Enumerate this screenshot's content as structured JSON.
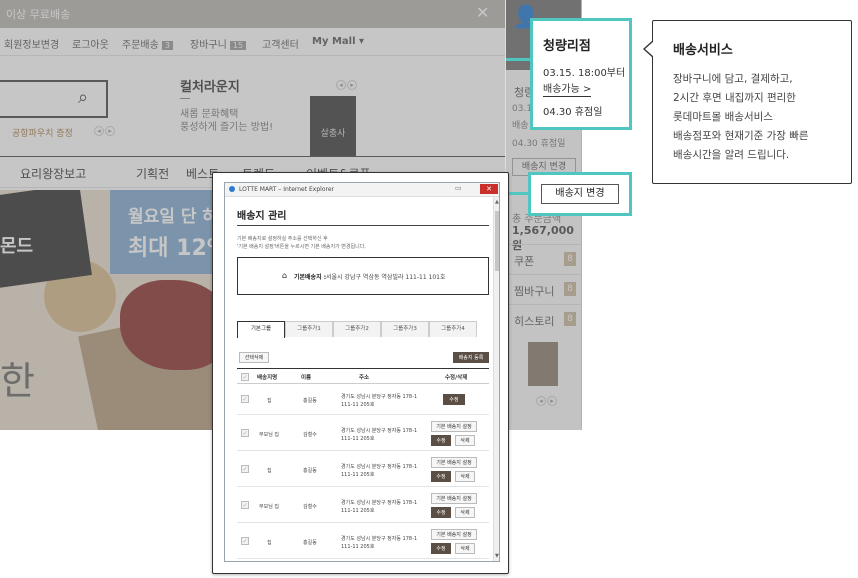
{
  "site": {
    "topbar_text": "이상 무료배송",
    "util_links": [
      {
        "label": "회원정보변경",
        "count": ""
      },
      {
        "label": "로그아웃",
        "count": ""
      },
      {
        "label": "주문배송",
        "count": "3"
      },
      {
        "label": "장바구니",
        "count": "15"
      },
      {
        "label": "고객센터",
        "count": ""
      },
      {
        "label": "My Mall ▾",
        "count": ""
      }
    ],
    "search_promo": "공항파우치 증정",
    "lounge": {
      "title": "컬처라운지",
      "line1": "새롭 문화혜택",
      "line2": "풍성하게 즐기는 방법!"
    },
    "book_title": "살충사",
    "gnb": [
      "요리왕장보고",
      "기획전",
      "베스트",
      "트렌드",
      "이벤트&쿠폰"
    ],
    "banner": {
      "line1": "월요일 단 하루",
      "line2": "최대 12%",
      "bag_text": "몬드",
      "side_text": "한"
    }
  },
  "right_panel": {
    "store_fragment": "청량",
    "info": [
      "03.15",
      "배송",
      "04.30 휴점일"
    ],
    "change_label": "배송지 변경",
    "amount_label": "총 주문금액",
    "amount": "1,567,000원",
    "rows": [
      {
        "label": "쿠폰",
        "count": "8"
      },
      {
        "label": "찜바구니",
        "count": "8"
      },
      {
        "label": "히스토리",
        "count": "8"
      }
    ]
  },
  "store_card": {
    "name": "청량리점",
    "time": "03.15. 18:00부터",
    "available": "배송가능 >",
    "closed": "04.30 휴점일"
  },
  "change_button": {
    "label": "배송지 변경"
  },
  "callout": {
    "title": "배송서비스",
    "lines": [
      "장바구니에 담고, 결제하고,",
      "2시간 후면 내집까지 편리한",
      "롯데마트몰 배송서비스",
      "배송점포와 현재기준 가장 빠른",
      "배송시간을 알려 드립니다."
    ]
  },
  "ie_window": {
    "title": "LOTTE MART – Internet Explorer",
    "minmax": "▭",
    "close": "✕",
    "page_title": "배송지 관리",
    "desc1": "기본 배송지로 설정하실 주소를 선택하신 후",
    "desc2": "'기본 배송지 설정'버튼을 누르시면 기본 배송지가 변경됩니다.",
    "default_label": "기본배송지 :",
    "default_address": "서울시 강남구 역삼동 역삼빌라 111-11 101호",
    "tabs": [
      "기본그룹",
      "그룹추가1",
      "그룹추가2",
      "그룹추가3",
      "그룹추가4"
    ],
    "select_delete": "선택삭제",
    "register": "배송지 등록",
    "columns": [
      "배송지명",
      "이름",
      "주소",
      "수정/삭제"
    ],
    "rows": [
      {
        "place": "집",
        "name": "홍길동",
        "addr1": "경기도 성남시 분당구 정자동 178-1",
        "addr2": "111-11 205호",
        "default_btn": "",
        "edit": "수정",
        "del": ""
      },
      {
        "place": "부모님 집",
        "name": "김철수",
        "addr1": "경기도 성남시 분당구 정자동 178-1",
        "addr2": "111-11 205호",
        "default_btn": "기본 배송지 설정",
        "edit": "수정",
        "del": "삭제"
      },
      {
        "place": "집",
        "name": "홍길동",
        "addr1": "경기도 성남시 분당구 정자동 178-1",
        "addr2": "111-11 205호",
        "default_btn": "기본 배송지 설정",
        "edit": "수정",
        "del": "삭제"
      },
      {
        "place": "부모님 집",
        "name": "김철수",
        "addr1": "경기도 성남시 분당구 정자동 178-1",
        "addr2": "111-11 205호",
        "default_btn": "기본 배송지 설정",
        "edit": "수정",
        "del": "삭제"
      },
      {
        "place": "집",
        "name": "홍길동",
        "addr1": "경기도 성남시 분당구 정자동 178-1",
        "addr2": "111-11 205호",
        "default_btn": "기본 배송지 설정",
        "edit": "수정",
        "del": "삭제"
      }
    ]
  },
  "colors": {
    "accent": "#4fc7c0",
    "dark_button": "#5a4e45",
    "badge": "#c8b89e"
  }
}
